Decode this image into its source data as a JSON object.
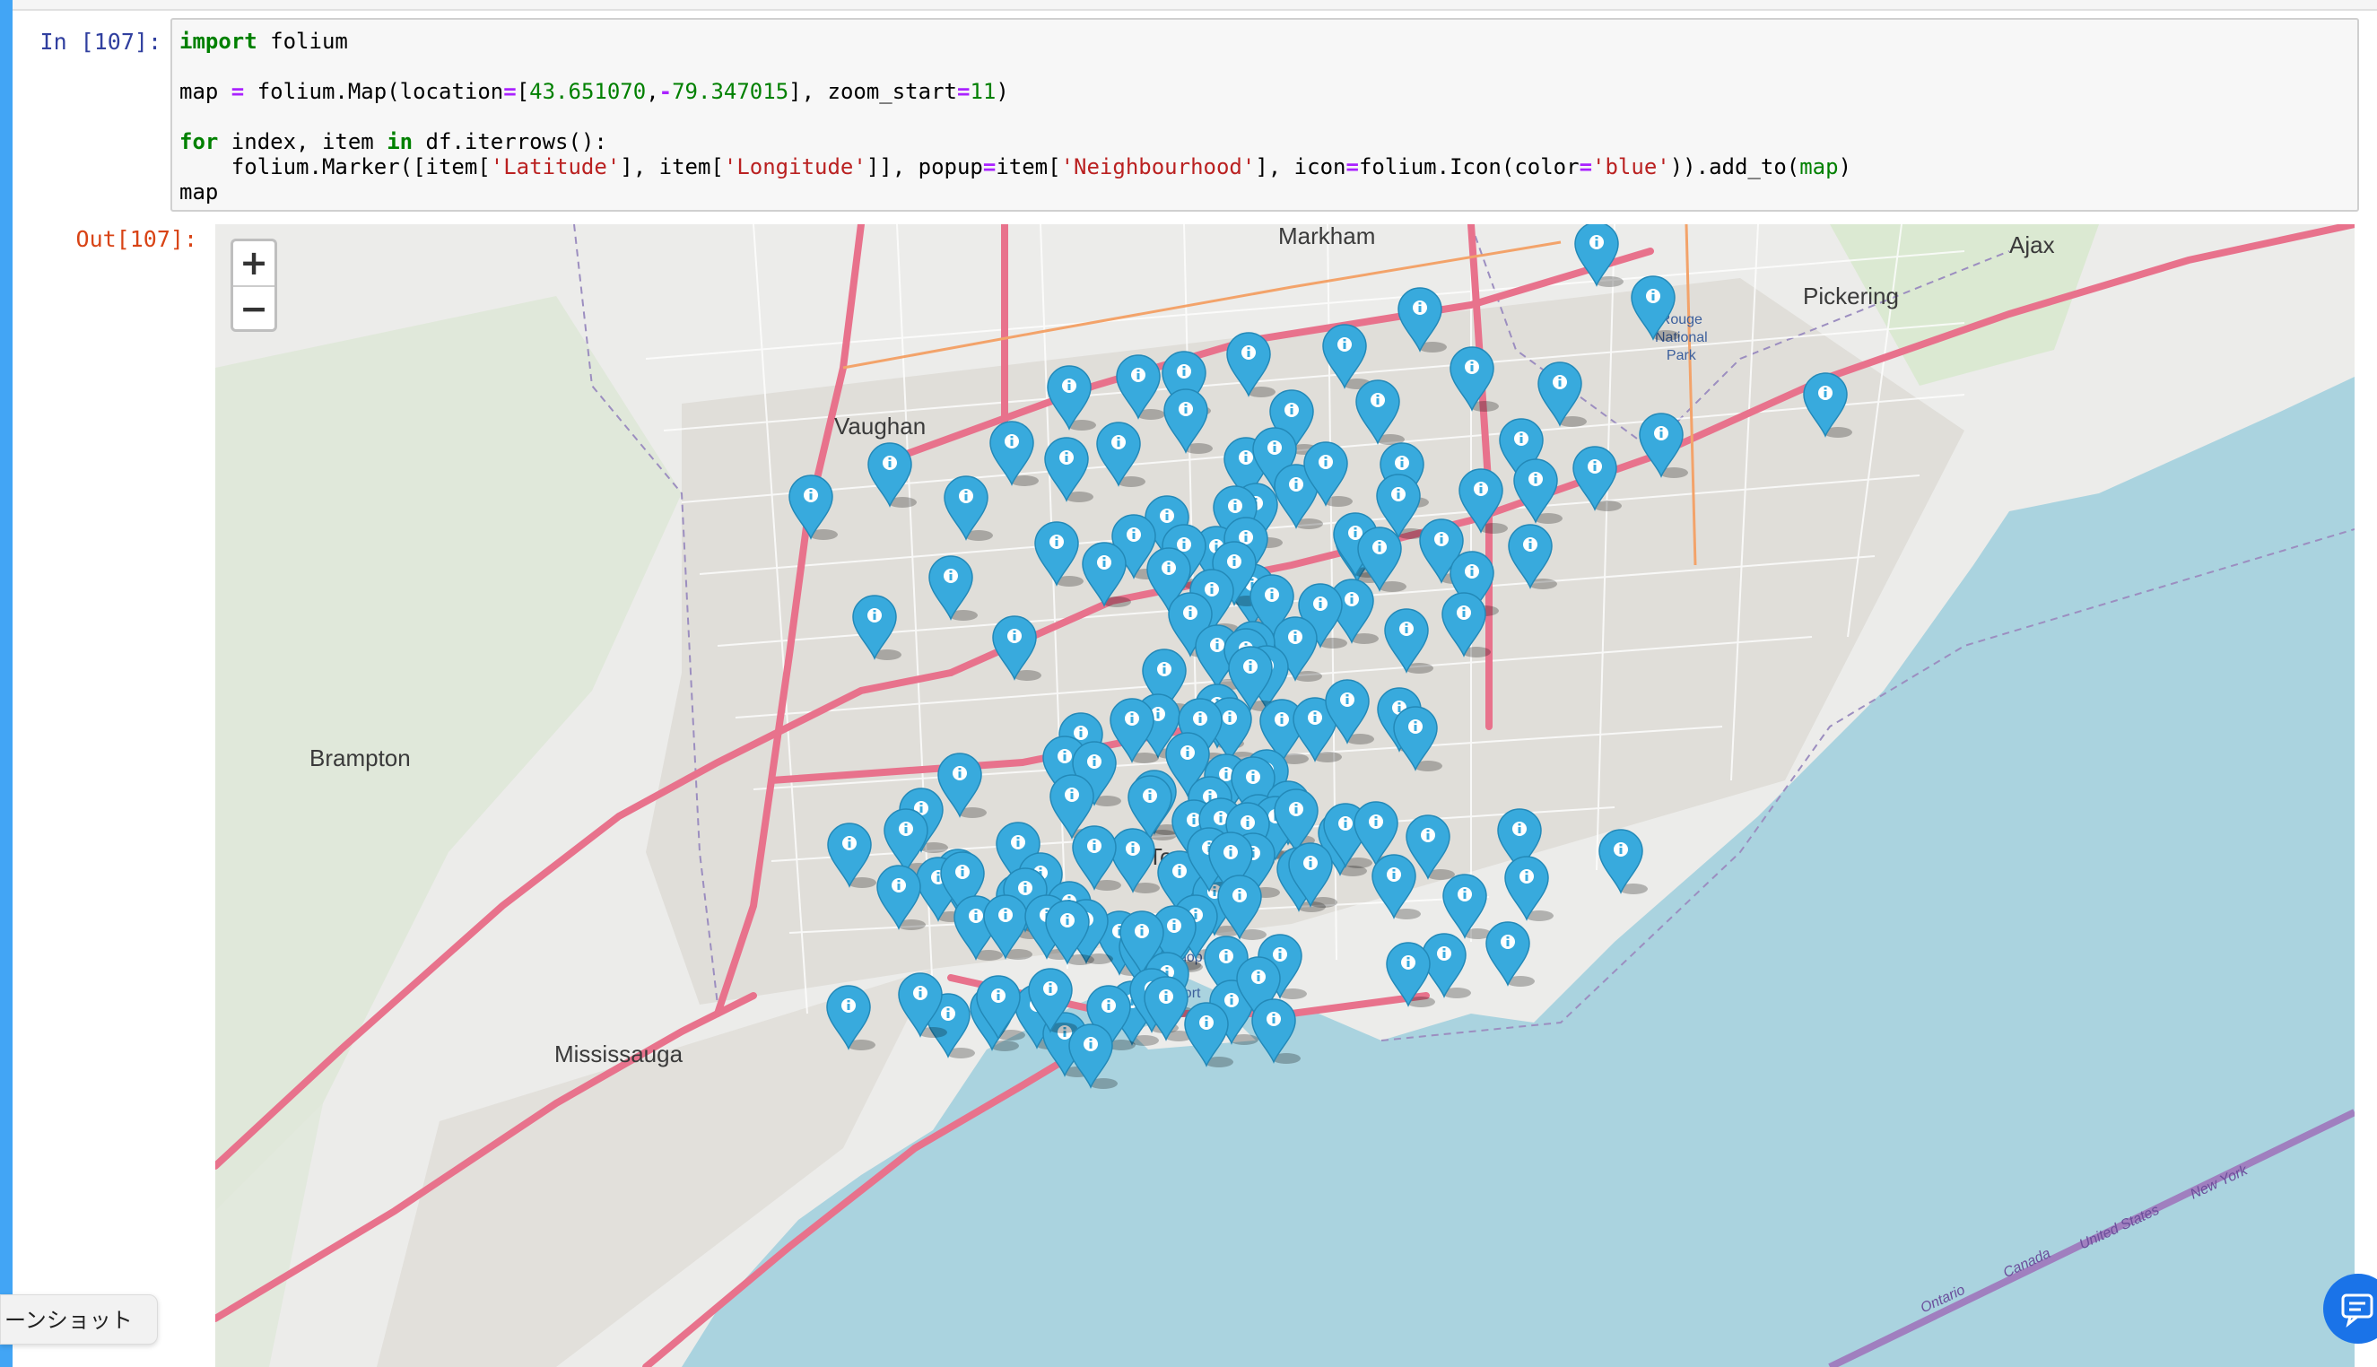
{
  "cell": {
    "in_prompt": "In [107]:",
    "out_prompt": "Out[107]:",
    "code_lines": [
      [
        {
          "t": "import",
          "c": "kw"
        },
        {
          "t": " folium",
          "c": ""
        }
      ],
      [],
      [
        {
          "t": "map ",
          "c": ""
        },
        {
          "t": "=",
          "c": "op"
        },
        {
          "t": " folium.Map(location",
          "c": ""
        },
        {
          "t": "=",
          "c": "op"
        },
        {
          "t": "[",
          "c": ""
        },
        {
          "t": "43.651070",
          "c": "num"
        },
        {
          "t": ",",
          "c": ""
        },
        {
          "t": "-",
          "c": "op"
        },
        {
          "t": "79.347015",
          "c": "num"
        },
        {
          "t": "], zoom_start",
          "c": ""
        },
        {
          "t": "=",
          "c": "op"
        },
        {
          "t": "11",
          "c": "num"
        },
        {
          "t": ")",
          "c": ""
        }
      ],
      [],
      [
        {
          "t": "for",
          "c": "kw"
        },
        {
          "t": " index, item ",
          "c": ""
        },
        {
          "t": "in",
          "c": "kw"
        },
        {
          "t": " df.iterrows():",
          "c": ""
        }
      ],
      [
        {
          "t": "    folium.Marker([item[",
          "c": ""
        },
        {
          "t": "'Latitude'",
          "c": "str"
        },
        {
          "t": "], item[",
          "c": ""
        },
        {
          "t": "'Longitude'",
          "c": "str"
        },
        {
          "t": "]], popup",
          "c": ""
        },
        {
          "t": "=",
          "c": "op"
        },
        {
          "t": "item[",
          "c": ""
        },
        {
          "t": "'Neighbourhood'",
          "c": "str"
        },
        {
          "t": "], icon",
          "c": ""
        },
        {
          "t": "=",
          "c": "op"
        },
        {
          "t": "folium.Icon(color",
          "c": ""
        },
        {
          "t": "=",
          "c": "op"
        },
        {
          "t": "'blue'",
          "c": "str"
        },
        {
          "t": ")).add_to(",
          "c": ""
        },
        {
          "t": "map",
          "c": "bi"
        },
        {
          "t": ")",
          "c": ""
        }
      ],
      [
        {
          "t": "map",
          "c": ""
        }
      ]
    ]
  },
  "map": {
    "zoom_in": "+",
    "zoom_out": "−",
    "marker_color": "#38aadd",
    "water_color": "#aad3df",
    "land_color": "#ececea",
    "road_color": "#e8728c",
    "labels": [
      {
        "text": "Markham",
        "cls": "lbl-city"
      },
      {
        "text": "Ajax",
        "cls": "lbl-city"
      },
      {
        "text": "Pickering",
        "cls": "lbl-city"
      },
      {
        "text": "Vaughan",
        "cls": "lbl-city"
      },
      {
        "text": "Brampton",
        "cls": "lbl-city"
      },
      {
        "text": "Mississauga",
        "cls": "lbl-city"
      },
      {
        "text": "Toronto",
        "cls": "lbl-city"
      },
      {
        "text": "Rouge\nNational\nPark",
        "cls": "lbl-small"
      },
      {
        "text": "Billy Bishop\nToronto\nCity Airport",
        "cls": "lbl-small"
      },
      {
        "text": "Ontario",
        "cls": "lbl-small"
      },
      {
        "text": "Canada",
        "cls": "lbl-small"
      },
      {
        "text": "United States",
        "cls": "lbl-small"
      },
      {
        "text": "New York",
        "cls": "lbl-small"
      }
    ]
  },
  "ui": {
    "screenshot_tab": "ーンショット",
    "chat_icon": "chat-icon"
  }
}
